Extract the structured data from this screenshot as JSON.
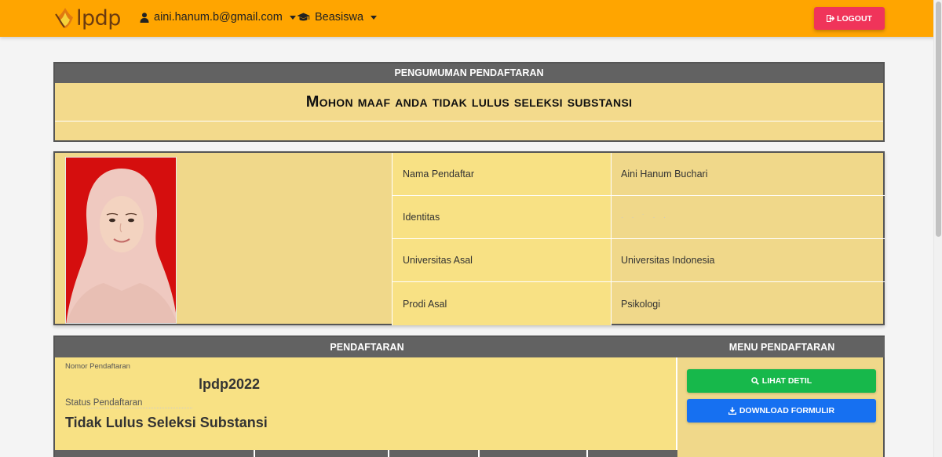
{
  "navbar": {
    "logo_text": "lpdp",
    "user_email": "aini.hanum.b@gmail.com",
    "beasiswa_label": "Beasiswa",
    "logout_label": "LOGOUT"
  },
  "announcement": {
    "header": "PENGUMUMAN PENDAFTARAN",
    "message": "Mohon maaf anda tidak lulus seleksi substansi"
  },
  "profile": {
    "rows": [
      {
        "label": "Nama Pendaftar",
        "value": "Aini Hanum Buchari"
      },
      {
        "label": "Identitas",
        "value": ""
      },
      {
        "label": "Universitas Asal",
        "value": "Universitas Indonesia"
      },
      {
        "label": "Prodi Asal",
        "value": "Psikologi"
      }
    ]
  },
  "registration": {
    "header": "PENDAFTARAN",
    "menu_header": "MENU PENDAFTARAN",
    "number_label": "Nomor Pendaftaran",
    "number_value": "lpdp2022",
    "status_label": "Status Pendaftaran",
    "status_value": "Tidak Lulus Seleksi Substansi",
    "view_button": "LIHAT DETIL",
    "download_button": "DOWNLOAD FORMULIR"
  },
  "colors": {
    "navbar": "#ffa500",
    "logout": "#f0345a",
    "panel_header": "#626262",
    "panel_bg": "#f0d88a",
    "green": "#17b84b",
    "blue": "#1670f1"
  }
}
